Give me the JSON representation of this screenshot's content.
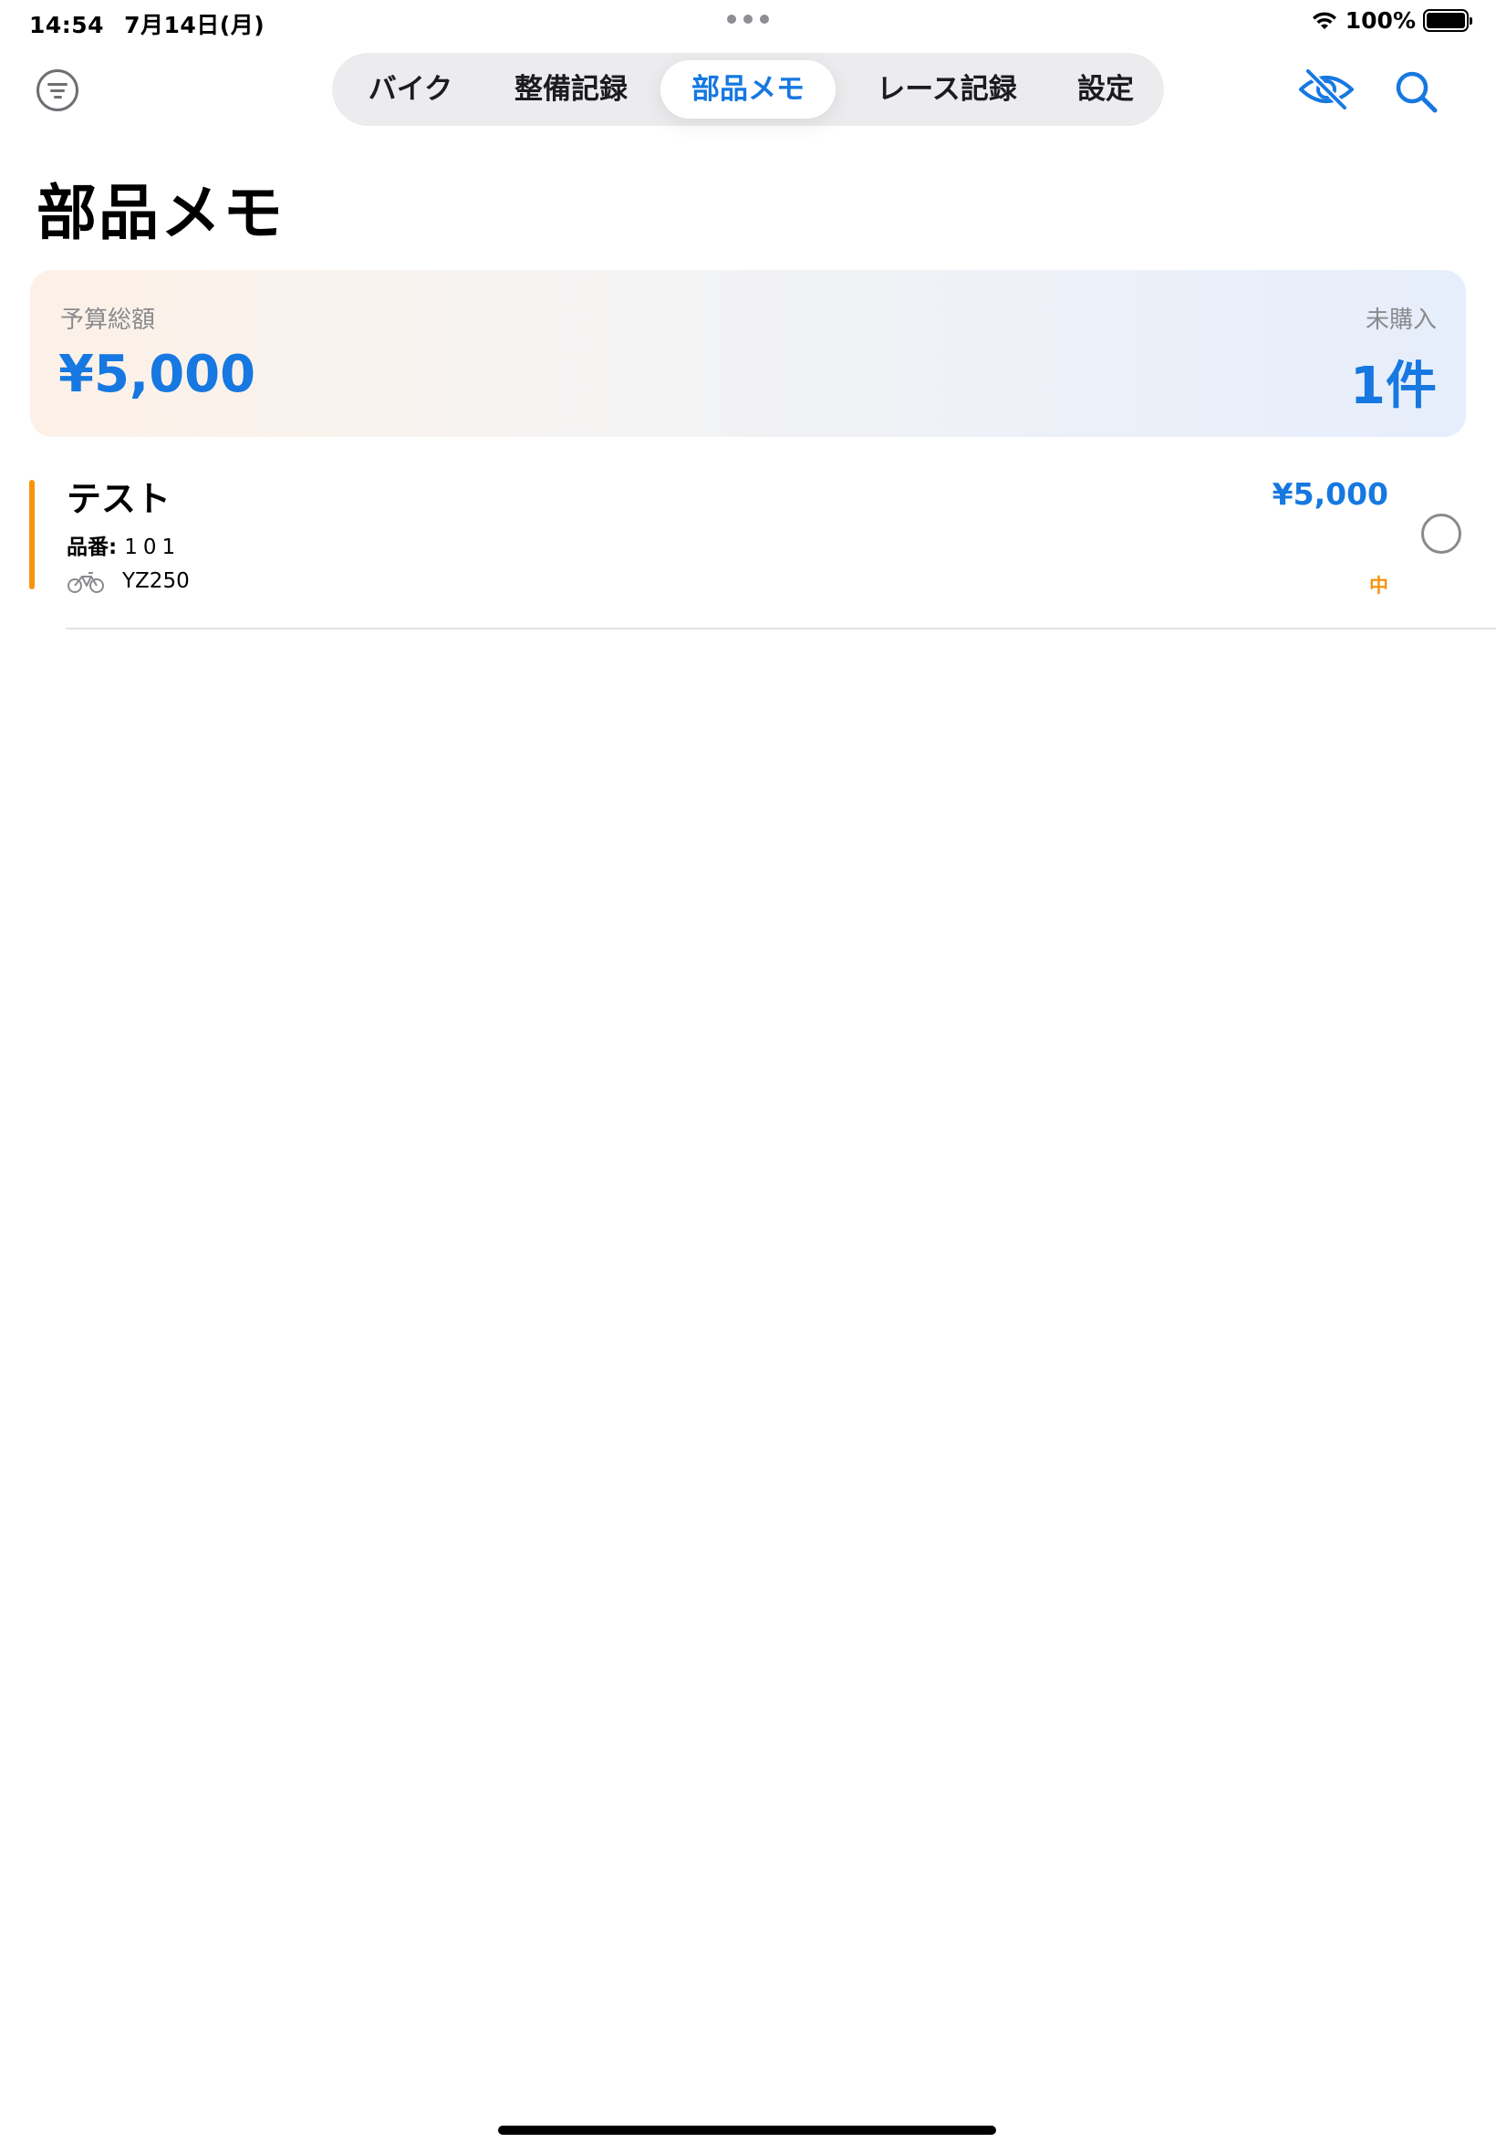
{
  "status_bar": {
    "time": "14:54",
    "date": "7月14日(月)",
    "battery": "100%"
  },
  "tabs": [
    {
      "label": "バイク",
      "active": false
    },
    {
      "label": "整備記録",
      "active": false
    },
    {
      "label": "部品メモ",
      "active": true
    },
    {
      "label": "レース記録",
      "active": false
    },
    {
      "label": "設定",
      "active": false
    }
  ],
  "header": {
    "title": "部品メモ",
    "filter_icon": "filter-lines-icon",
    "visibility_icon": "eye-slash-icon",
    "search_icon": "search-icon"
  },
  "summary": {
    "budget_label": "予算総額",
    "budget_value": "¥5,000",
    "unbought_label": "未購入",
    "unbought_value": "1件"
  },
  "items": [
    {
      "name": "テスト",
      "part_no_label": "品番:",
      "part_no": "101",
      "bike": "YZ250",
      "price": "¥5,000",
      "priority": "中",
      "purchased": false
    }
  ],
  "colors": {
    "accent": "#1678e0",
    "priority_medium": "#f7940e",
    "secondary_text": "#8a8a8e"
  }
}
